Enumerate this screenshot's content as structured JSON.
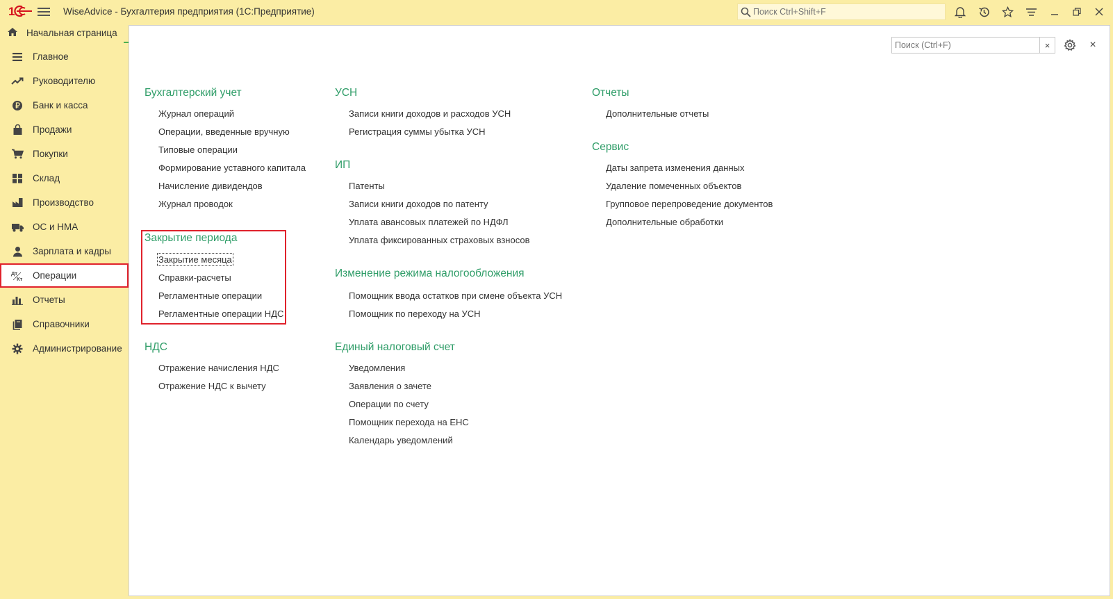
{
  "titlebar": {
    "app_title": "WiseAdvice - Бухгалтерия предприятия  (1С:Предприятие)",
    "search_placeholder": "Поиск Ctrl+Shift+F"
  },
  "home_tab": {
    "label": "Начальная страница"
  },
  "sidebar": {
    "items": [
      {
        "label": "Главное",
        "icon": "list-icon"
      },
      {
        "label": "Руководителю",
        "icon": "trend-icon"
      },
      {
        "label": "Банк и касса",
        "icon": "ruble-coin-icon"
      },
      {
        "label": "Продажи",
        "icon": "shopping-bag-icon"
      },
      {
        "label": "Покупки",
        "icon": "cart-icon"
      },
      {
        "label": "Склад",
        "icon": "warehouse-grid-icon"
      },
      {
        "label": "Производство",
        "icon": "factory-icon"
      },
      {
        "label": "ОС и НМА",
        "icon": "truck-icon"
      },
      {
        "label": "Зарплата и кадры",
        "icon": "person-icon"
      },
      {
        "label": "Операции",
        "icon": "dt-kt-icon",
        "active": true
      },
      {
        "label": "Отчеты",
        "icon": "bar-chart-icon"
      },
      {
        "label": "Справочники",
        "icon": "books-icon"
      },
      {
        "label": "Администрирование",
        "icon": "gear-icon"
      }
    ]
  },
  "panel": {
    "search_placeholder": "Поиск (Ctrl+F)",
    "clear_label": "×",
    "close_label": "×"
  },
  "sections": {
    "accounting": {
      "title": "Бухгалтерский учет",
      "links": [
        "Журнал операций",
        "Операции, введенные вручную",
        "Типовые операции",
        "Формирование уставного капитала",
        "Начисление дивидендов",
        "Журнал проводок"
      ]
    },
    "period_close": {
      "title": "Закрытие периода",
      "links": [
        "Закрытие месяца",
        "Справки-расчеты",
        "Регламентные операции",
        "Регламентные операции НДС"
      ]
    },
    "vat": {
      "title": "НДС",
      "links": [
        "Отражение начисления НДС",
        "Отражение НДС к вычету"
      ]
    },
    "usn": {
      "title": "УСН",
      "links": [
        "Записи книги доходов и расходов УСН",
        "Регистрация суммы убытка УСН"
      ]
    },
    "ip": {
      "title": "ИП",
      "links": [
        "Патенты",
        "Записи книги доходов по патенту",
        "Уплата авансовых платежей по НДФЛ",
        "Уплата фиксированных страховых взносов"
      ]
    },
    "tax_mode": {
      "title": "Изменение режима налогообложения",
      "links": [
        "Помощник ввода остатков при смене объекта УСН",
        "Помощник по переходу на УСН"
      ]
    },
    "ens": {
      "title": "Единый налоговый счет",
      "links": [
        "Уведомления",
        "Заявления о зачете",
        "Операции по счету",
        "Помощник перехода на ЕНС",
        "Календарь уведомлений"
      ]
    },
    "reports": {
      "title": "Отчеты",
      "links": [
        "Дополнительные отчеты"
      ]
    },
    "service": {
      "title": "Сервис",
      "links": [
        "Даты запрета изменения данных",
        "Удаление помеченных объектов",
        "Групповое перепроведение документов",
        "Дополнительные обработки"
      ]
    }
  },
  "colors": {
    "accent_green": "#2f9d68",
    "highlight_red": "#e0222c",
    "chrome_yellow": "#fbeda4"
  }
}
